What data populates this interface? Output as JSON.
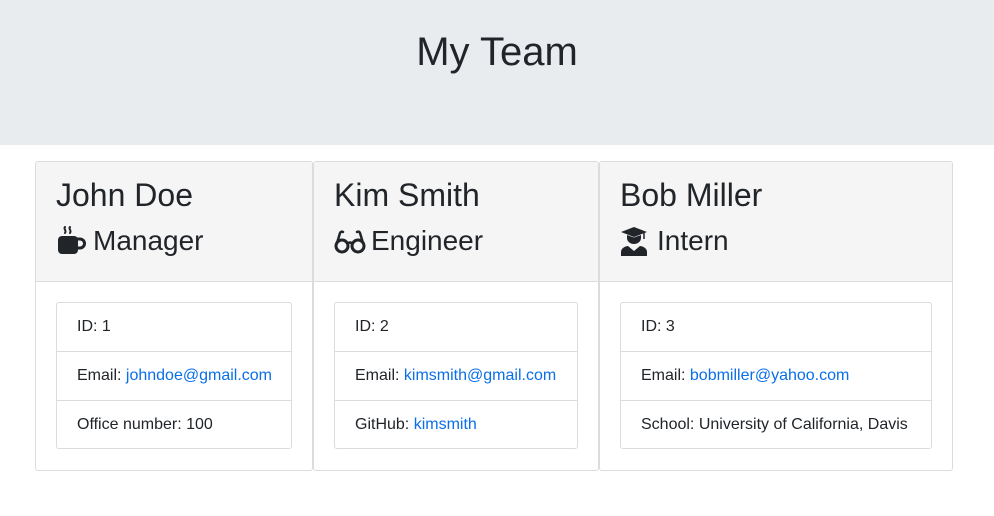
{
  "header": {
    "title": "My Team"
  },
  "employees": [
    {
      "name": "John Doe",
      "role": "Manager",
      "role_icon": "mug-icon",
      "id_label": "ID: 1",
      "email_prefix": "Email: ",
      "email": "johndoe@gmail.com",
      "extra_prefix": "Office number: 100",
      "extra_value": ""
    },
    {
      "name": "Kim Smith",
      "role": "Engineer",
      "role_icon": "glasses-icon",
      "id_label": "ID: 2",
      "email_prefix": "Email: ",
      "email": "kimsmith@gmail.com",
      "extra_prefix": "GitHub: ",
      "extra_value": "kimsmith"
    },
    {
      "name": "Bob Miller",
      "role": "Intern",
      "role_icon": "graduate-icon",
      "id_label": "ID: 3",
      "email_prefix": "Email: ",
      "email": "bobmiller@yahoo.com",
      "extra_prefix": "School: University of California, Davis",
      "extra_value": ""
    }
  ],
  "colors": {
    "header_bg": "#e9ecef",
    "card_header_bg": "#f5f5f5",
    "link": "#0a6fe8",
    "text": "#212529"
  }
}
